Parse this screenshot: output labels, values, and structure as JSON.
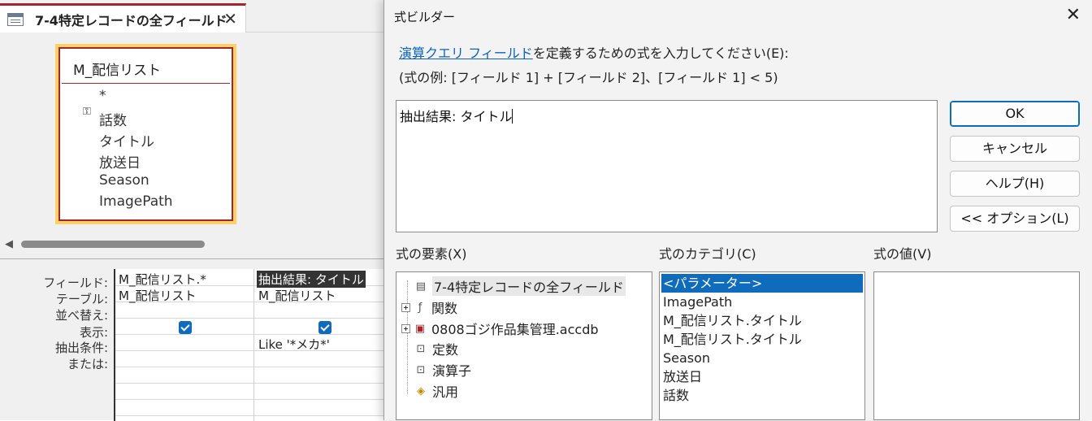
{
  "query_window": {
    "tab_title": "7-4特定レコードの全フィールド",
    "tab_close": "✕",
    "table": {
      "name": "M_配信リスト",
      "fields": [
        "*",
        "話数",
        "タイトル",
        "放送日",
        "Season",
        "ImagePath"
      ]
    },
    "grid": {
      "row_labels": [
        "フィールド:",
        "テーブル:",
        "並べ替え:",
        "表示:",
        "抽出条件:",
        "または:"
      ],
      "columns": [
        {
          "field": "M_配信リスト.*",
          "table": "M_配信リスト",
          "show": true,
          "criteria": ""
        },
        {
          "field": "抽出結果: タイトル",
          "table": "M_配信リスト",
          "show": true,
          "criteria": "Like '*メカ*'"
        }
      ]
    }
  },
  "dialog": {
    "title": "式ビルダー",
    "close": "✕",
    "prompt_link": "演算クエリ フィールド",
    "prompt_rest": "を定義するための式を入力してください(E):",
    "example": "(式の例: [フィールド 1] + [フィールド 2]、[フィールド 1] < 5)",
    "expression": "抽出結果: タイトル",
    "buttons": {
      "ok": "OK",
      "cancel": "キャンセル",
      "help": "ヘルプ(H)",
      "options": "<< オプション(L)"
    },
    "elements_label": "式の要素(X)",
    "categories_label": "式のカテゴリ(C)",
    "values_label": "式の値(V)",
    "elements": [
      {
        "label": "7-4特定レコードの全フィールド",
        "expandable": false,
        "icon": "query-icon"
      },
      {
        "label": "関数",
        "expandable": true,
        "icon": "function-icon"
      },
      {
        "label": "0808ゴジ作品集管理.accdb",
        "expandable": true,
        "icon": "database-icon"
      },
      {
        "label": "定数",
        "expandable": false,
        "icon": "constant-icon"
      },
      {
        "label": "演算子",
        "expandable": false,
        "icon": "operator-icon"
      },
      {
        "label": "汎用",
        "expandable": false,
        "icon": "common-icon"
      }
    ],
    "categories": [
      "<パラメーター>",
      "ImagePath",
      "M_配信リスト.タイトル",
      "M_配信リスト.タイトル",
      "Season",
      "放送日",
      "話数"
    ]
  }
}
